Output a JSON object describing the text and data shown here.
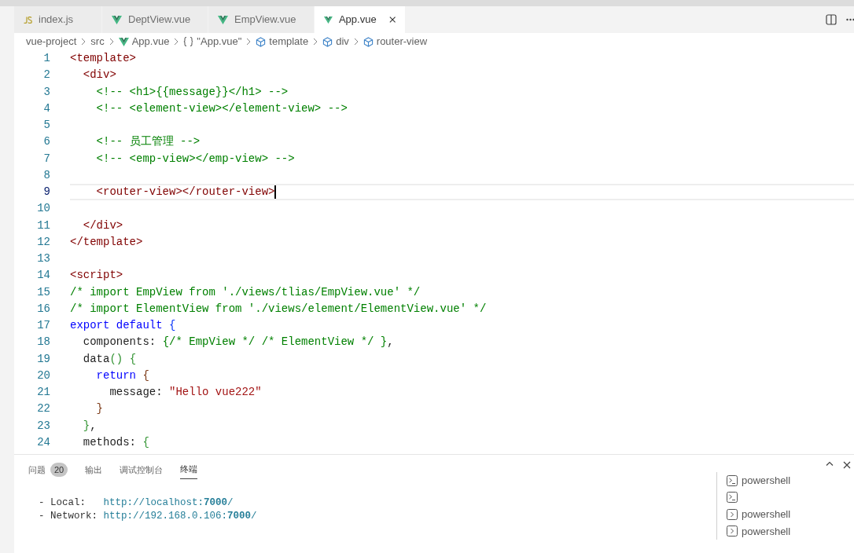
{
  "tabs": [
    {
      "label": "index.js",
      "kind": "js",
      "selected": false
    },
    {
      "label": "DeptView.vue",
      "kind": "vue",
      "selected": false
    },
    {
      "label": "EmpView.vue",
      "kind": "vue",
      "selected": false
    },
    {
      "label": "App.vue",
      "kind": "vue",
      "selected": true
    }
  ],
  "breadcrumbs": [
    {
      "label": "vue-project",
      "kind": "folder"
    },
    {
      "label": "src",
      "kind": "folder"
    },
    {
      "label": "App.vue",
      "kind": "vue"
    },
    {
      "label": "\"App.vue\"",
      "kind": "object"
    },
    {
      "label": "template",
      "kind": "element"
    },
    {
      "label": "div",
      "kind": "element"
    },
    {
      "label": "router-view",
      "kind": "element"
    }
  ],
  "editor": {
    "lines": [
      {
        "number": "1",
        "current": false,
        "tokens": [
          {
            "text": "<template>",
            "kind": "tag"
          }
        ]
      },
      {
        "number": "2",
        "current": false,
        "tokens": [
          {
            "text": "  <div>",
            "kind": "tag"
          }
        ]
      },
      {
        "number": "3",
        "current": false,
        "tokens": [
          {
            "text": "    <!-- <h1>{{message}}</h1> -->",
            "kind": "comment"
          }
        ]
      },
      {
        "number": "4",
        "current": false,
        "tokens": [
          {
            "text": "    <!-- <element-view></element-view> -->",
            "kind": "comment"
          }
        ]
      },
      {
        "number": "5",
        "current": false
      },
      {
        "number": "6",
        "current": false,
        "tokens": [
          {
            "text": "    <!-- 员工管理 -->",
            "kind": "comment"
          }
        ]
      },
      {
        "number": "7",
        "current": false,
        "tokens": [
          {
            "text": "    <!-- <emp-view></emp-view> -->",
            "kind": "comment"
          }
        ]
      },
      {
        "number": "8",
        "current": false
      },
      {
        "number": "9",
        "current": true,
        "tokens": [
          {
            "text": "    <router-view></router-view>",
            "kind": "tag"
          }
        ]
      },
      {
        "number": "10",
        "current": false
      },
      {
        "number": "11",
        "current": false,
        "tokens": [
          {
            "text": "  </div>",
            "kind": "tag"
          }
        ]
      },
      {
        "number": "12",
        "current": false,
        "tokens": [
          {
            "text": "</template>",
            "kind": "tag"
          }
        ]
      },
      {
        "number": "13",
        "current": false
      },
      {
        "number": "14",
        "current": false,
        "tokens": [
          {
            "text": "<script>",
            "kind": "tag"
          }
        ]
      },
      {
        "number": "15",
        "current": false,
        "tokens": [
          {
            "text": "/* import EmpView from './views/tlias/EmpView.vue' */",
            "kind": "comment"
          }
        ]
      },
      {
        "number": "16",
        "current": false,
        "tokens": [
          {
            "text": "/* import ElementView from './views/element/ElementView.vue' */",
            "kind": "comment"
          }
        ]
      },
      {
        "number": "17",
        "current": false,
        "tokens": [
          {
            "text": "export default ",
            "kind": "keyword"
          },
          {
            "text": "{",
            "kind": "brace1"
          }
        ]
      },
      {
        "number": "18",
        "current": false,
        "tokens": [
          {
            "text": "  components: ",
            "kind": "plain"
          },
          {
            "text": "{/* EmpView */ /* ElementView */ }",
            "kind": "comment"
          },
          {
            "text": ",",
            "kind": "plain"
          }
        ]
      },
      {
        "number": "19",
        "current": false,
        "tokens": [
          {
            "text": "  data",
            "kind": "plain"
          },
          {
            "text": "() {",
            "kind": "brace2"
          }
        ]
      },
      {
        "number": "20",
        "current": false,
        "tokens": [
          {
            "text": "    return ",
            "kind": "keyword"
          },
          {
            "text": "{",
            "kind": "brace3"
          }
        ]
      },
      {
        "number": "21",
        "current": false,
        "tokens": [
          {
            "text": "      message: ",
            "kind": "plain"
          },
          {
            "text": "\"Hello vue222\"",
            "kind": "string"
          }
        ]
      },
      {
        "number": "22",
        "current": false,
        "tokens": [
          {
            "text": "    }",
            "kind": "brace3"
          }
        ]
      },
      {
        "number": "23",
        "current": false,
        "tokens": [
          {
            "text": "  }",
            "kind": "brace2"
          },
          {
            "text": ",",
            "kind": "plain"
          }
        ]
      },
      {
        "number": "24",
        "current": false,
        "tokens": [
          {
            "text": "  methods: ",
            "kind": "plain"
          },
          {
            "text": "{",
            "kind": "brace2"
          }
        ]
      }
    ]
  },
  "panel": {
    "tabs": [
      {
        "label": "问题",
        "badge": "20",
        "selected": false
      },
      {
        "label": "输出",
        "selected": false
      },
      {
        "label": "调试控制台",
        "selected": false
      },
      {
        "label": "终端",
        "selected": true
      }
    ],
    "terminal_lines": [
      {
        "label": "  - Local:   ",
        "url": "http://localhost:",
        "port": "7000",
        "tail": "/"
      },
      {
        "label": "  - Network: ",
        "url": "http://192.168.0.106:",
        "port": "7000",
        "tail": "/"
      }
    ],
    "terminals": [
      {
        "label": "powershell",
        "kind": "prompt"
      },
      {
        "kind": "prompt"
      },
      {
        "label": "powershell",
        "kind": "chevron"
      },
      {
        "label": "powershell",
        "kind": "chevron"
      }
    ]
  }
}
